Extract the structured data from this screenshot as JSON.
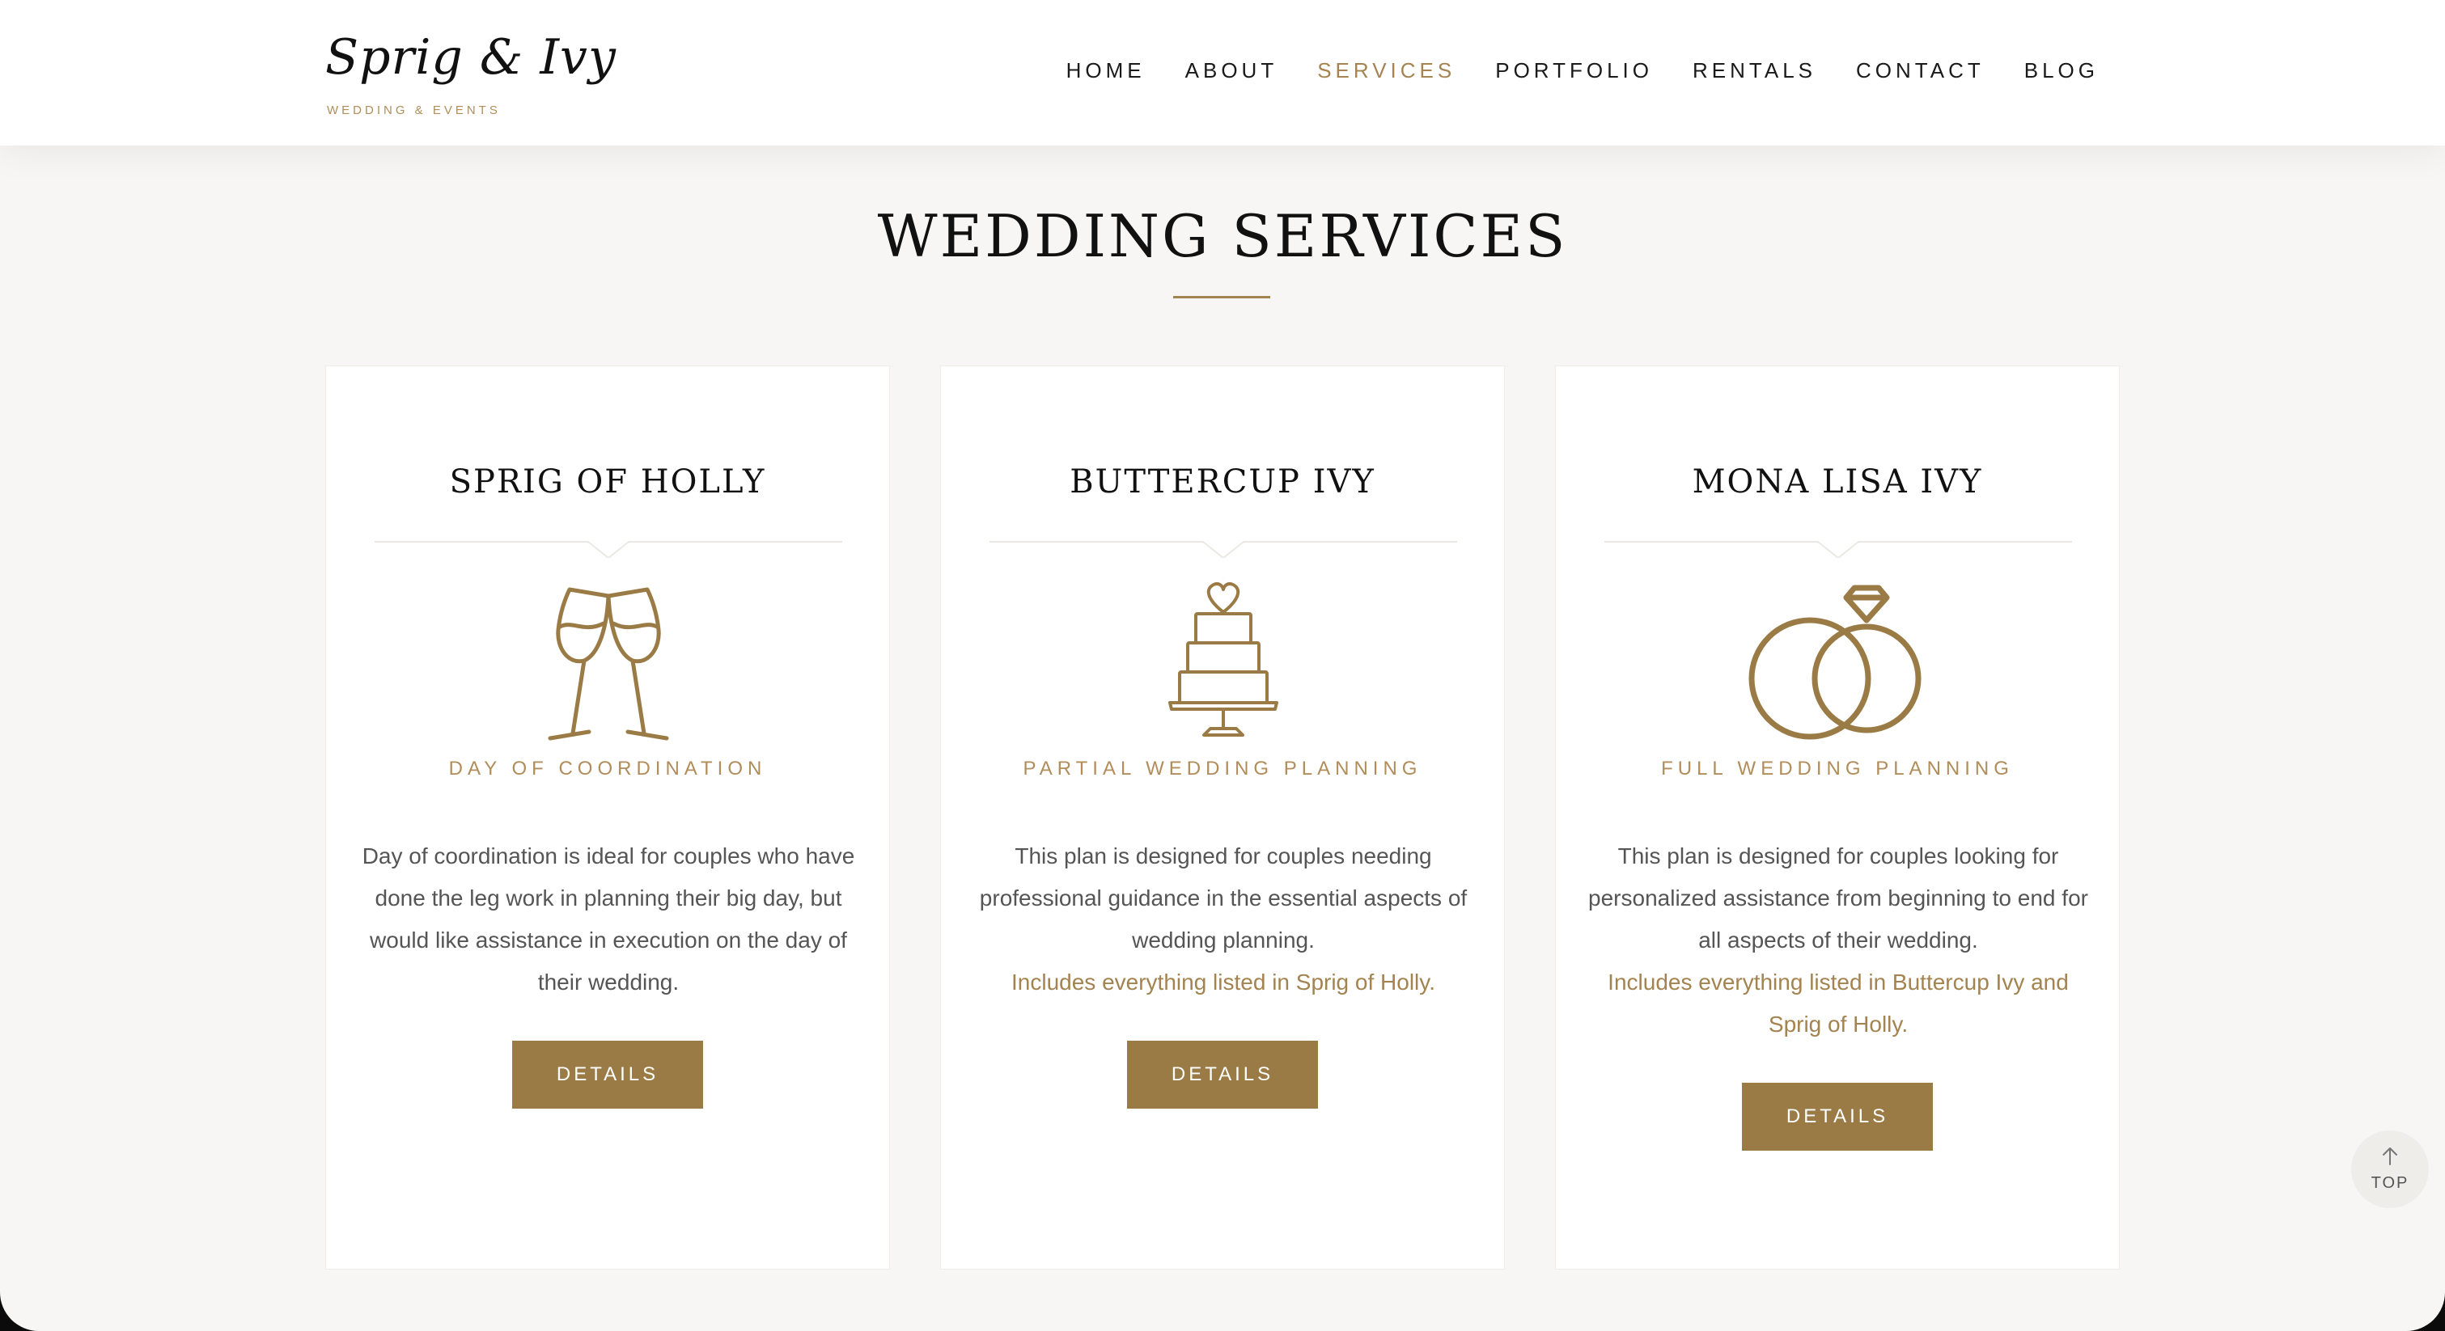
{
  "brand": {
    "logo_script": "Sprig & Ivy",
    "logo_sub": "WEDDING & EVENTS",
    "accent_color": "#9a7b46"
  },
  "nav": {
    "items": [
      {
        "label": "HOME",
        "active": false
      },
      {
        "label": "ABOUT",
        "active": false
      },
      {
        "label": "SERVICES",
        "active": true
      },
      {
        "label": "PORTFOLIO",
        "active": false
      },
      {
        "label": "RENTALS",
        "active": false
      },
      {
        "label": "CONTACT",
        "active": false
      },
      {
        "label": "BLOG",
        "active": false
      }
    ]
  },
  "section": {
    "title": "WEDDING SERVICES"
  },
  "cards": [
    {
      "title": "SPRIG OF HOLLY",
      "icon": "champagne-glasses-icon",
      "subtitle": "DAY OF COORDINATION",
      "description": "Day of coordination is ideal for couples who have done the leg work in planning their big day, but would like assistance in execution on the day of their wedding.",
      "highlight": "",
      "button": "DETAILS"
    },
    {
      "title": "BUTTERCUP IVY",
      "icon": "wedding-cake-icon",
      "subtitle": "PARTIAL WEDDING PLANNING",
      "description": "This plan is designed for couples needing professional guidance in the essential aspects of wedding planning.",
      "highlight": "Includes everything listed in Sprig of Holly.",
      "button": "DETAILS"
    },
    {
      "title": "MONA LISA IVY",
      "icon": "wedding-rings-icon",
      "subtitle": "FULL WEDDING PLANNING",
      "description": "This plan is designed for couples looking for personalized assistance from beginning to end for all aspects of their wedding.",
      "highlight": "Includes everything listed in Buttercup Ivy and Sprig of Holly.",
      "button": "DETAILS"
    }
  ],
  "back_to_top": {
    "label": "TOP",
    "icon": "arrow-up-icon"
  }
}
